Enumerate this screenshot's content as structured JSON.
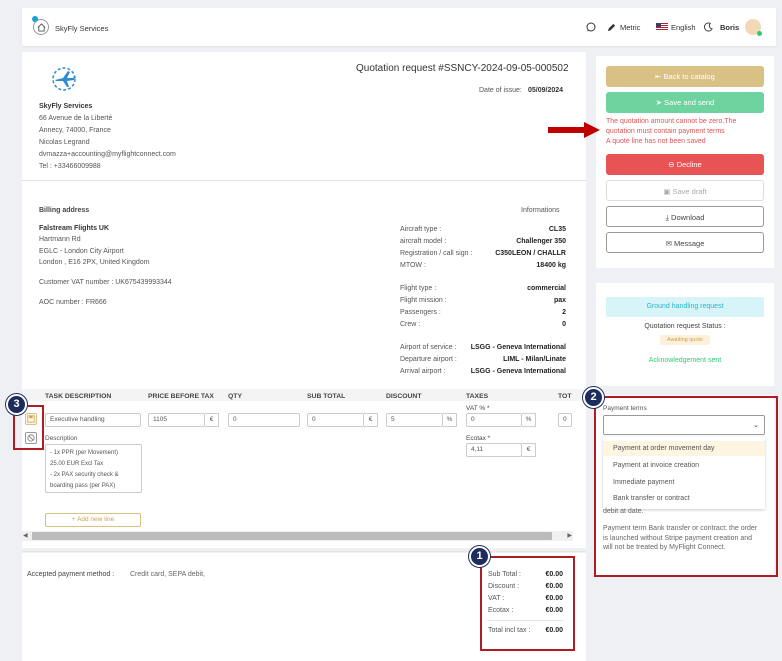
{
  "topbar": {
    "brand": "SkyFly Services",
    "metric": "Metric",
    "language": "English",
    "user": "Boris"
  },
  "quote": {
    "title": "Quotation request #SSNCY-2024-09-05-000502",
    "issue_label": "Date of issue:",
    "issue_date": "05/09/2024"
  },
  "company": {
    "name": "SkyFly Services",
    "lines": [
      "66 Avenue de la Liberté",
      "Annecy, 74000, France",
      "Nicolas Legrand",
      "dvmazza+accounting@myflightconnect.com",
      "Tel : +33466009988"
    ]
  },
  "billing": {
    "title": "Billing address",
    "name": "Falstream Flights UK",
    "lines": [
      "Hartmann Rd",
      "EGLC - London City Airport",
      "London , E16 2PX, United Kingdom"
    ],
    "vat": "Customer VAT number : UK675439993344",
    "aoc": "AOC number : FR666"
  },
  "info": {
    "title": "Informations",
    "rows1": [
      {
        "label": "Aircraft type :",
        "value": "CL35"
      },
      {
        "label": "aircraft model :",
        "value": "Challenger 350"
      },
      {
        "label": "Registration / call sign :",
        "value": "C350LEON / CHALLR"
      },
      {
        "label": "MTOW :",
        "value": "18400 kg"
      }
    ],
    "rows2": [
      {
        "label": "Flight type :",
        "value": "commercial"
      },
      {
        "label": "Flight mission :",
        "value": "pax"
      },
      {
        "label": "Passengers :",
        "value": "2"
      },
      {
        "label": "Crew :",
        "value": "0"
      }
    ],
    "rows3": [
      {
        "label": "Airport of service :",
        "value": "LSGG - Geneva International"
      },
      {
        "label": "Departure airport :",
        "value": "LIML - Milan/Linate"
      },
      {
        "label": "Arrival airport :",
        "value": "LSGG - Geneva International"
      }
    ]
  },
  "table": {
    "headers": [
      "TASK DESCRIPTION",
      "PRICE BEFORE TAX",
      "QTY",
      "SUB TOTAL",
      "DISCOUNT",
      "TAXES",
      "TOT"
    ],
    "task": "Executive handling",
    "price": "1105",
    "qty": "0",
    "subtotal": "0",
    "discount": "5",
    "vat_label": "VAT % *",
    "vat": "0",
    "ecotax_label": "Ecotax *",
    "ecotax": "4,11",
    "total": "0",
    "currency": "€",
    "percent": "%",
    "desc_label": "Description",
    "desc_lines": [
      "- 1x PPR (per Movement)",
      "25.00 EUR Excl Tax",
      "- 2x PAX security check &",
      "boarding pass (per PAX)"
    ],
    "add_line": "+ Add new line"
  },
  "payment": {
    "label": "Accepted payment method :",
    "value": "Credit card, SEPA debit,"
  },
  "totals": [
    {
      "label": "Sub Total :",
      "value": "€0.00"
    },
    {
      "label": "Discount :",
      "value": "€0.00"
    },
    {
      "label": "VAT :",
      "value": "€0.00"
    },
    {
      "label": "Ecotax :",
      "value": "€0.00"
    },
    {
      "label": "Total incl tax :",
      "value": "€0.00"
    }
  ],
  "actions": {
    "back": "Back to catalog",
    "save_send": "Save and send",
    "errors": [
      "The quotation amount cannot be zero.The",
      "quotation must contain payment terms",
      "A quote line has not been saved"
    ],
    "decline": "Decline",
    "save_draft": "Save draft",
    "download": "Download",
    "message": "Message"
  },
  "status": {
    "ground_handling": "Ground handling request",
    "status_label": "Quotation request Status :",
    "status_badge": "Awaiting quote",
    "ack": "Acknowledgement sent"
  },
  "terms": {
    "label": "Payment terms",
    "options": [
      "Payment at order movement day",
      "Payment at invoice creation",
      "Immediate payment",
      "Bank transfer or contract"
    ],
    "note1": "debit at date.",
    "note2": "Payment term Bank transfer or contract: the order is launched without Stripe payment creation and will not be treated by MyFlight Connect."
  },
  "callouts": [
    "1",
    "2",
    "3"
  ],
  "colors": {
    "back": "#d9c085",
    "save": "#6fd3a0",
    "decline": "#e85454",
    "error": "#e05555",
    "callout": "#b01c24",
    "badge": "#1d2c5c"
  }
}
